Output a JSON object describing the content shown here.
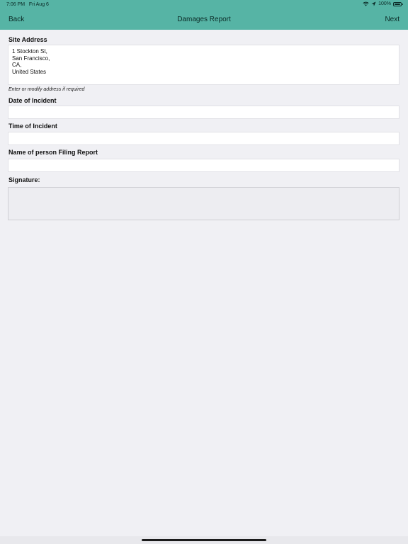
{
  "status_bar": {
    "time": "7:06 PM",
    "date": "Fri Aug 6",
    "battery_text": "100%",
    "battery_level": 1.0,
    "wifi_icon": "wifi-icon",
    "location_icon": "location-arrow-icon"
  },
  "nav": {
    "back_label": "Back",
    "title": "Damages Report",
    "next_label": "Next"
  },
  "form": {
    "site_address": {
      "label": "Site Address",
      "value": "1 Stockton St,\nSan Francisco,\nCA,\nUnited States",
      "hint": "Enter or modify address if required"
    },
    "date_of_incident": {
      "label": "Date of Incident",
      "value": ""
    },
    "time_of_incident": {
      "label": "Time of Incident",
      "value": ""
    },
    "name_filing": {
      "label": "Name of person Filing Report",
      "value": ""
    },
    "signature": {
      "label": "Signature:"
    }
  },
  "colors": {
    "header": "#56b4a5",
    "background": "#f0f0f4"
  }
}
